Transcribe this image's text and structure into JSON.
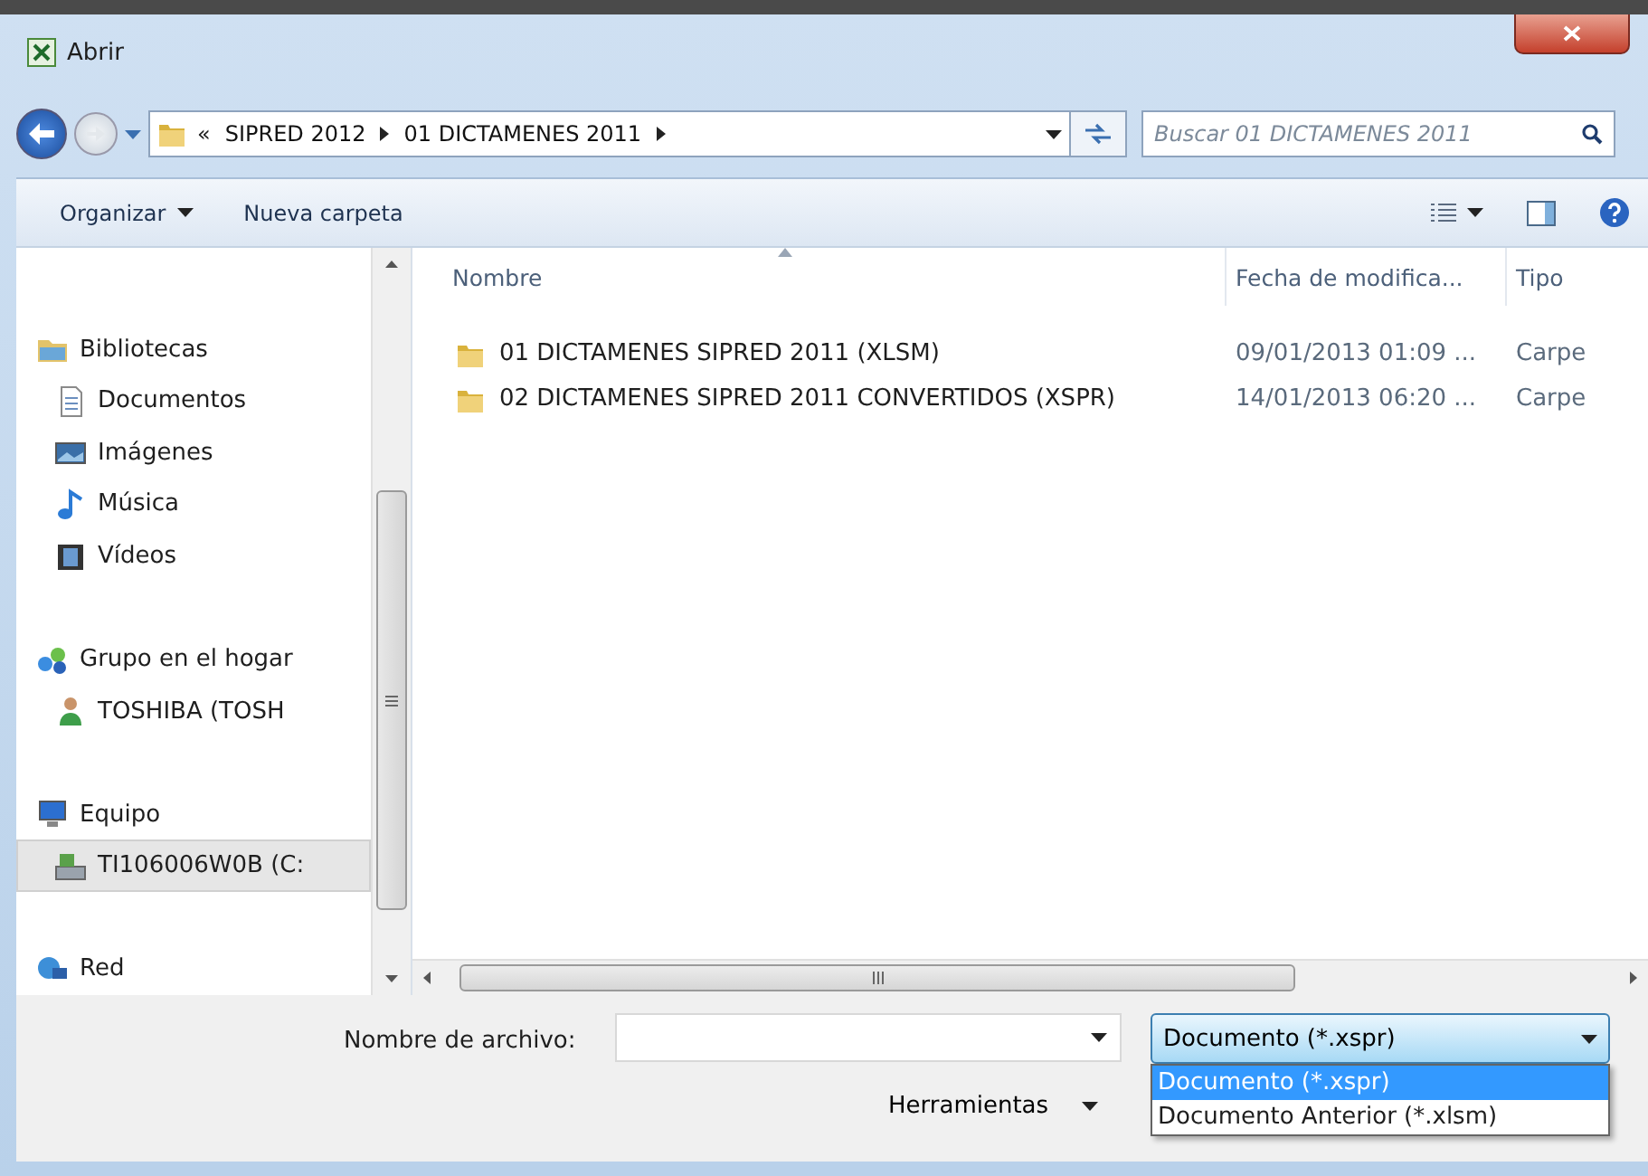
{
  "window": {
    "title": "Abrir"
  },
  "navigation": {
    "overflow": "«",
    "breadcrumb": [
      "SIPRED 2012",
      "01 DICTAMENES 2011"
    ],
    "search": {
      "placeholder": "Buscar 01 DICTAMENES 2011"
    }
  },
  "toolbar": [
    {
      "label": "Organizar",
      "dropdown": true
    },
    {
      "label": "Nueva carpeta",
      "dropdown": false
    }
  ],
  "sidebar": {
    "items": [
      {
        "label": "Bibliotecas",
        "kind": "library",
        "selected": false,
        "children": [
          {
            "label": "Documentos",
            "kind": "documents",
            "selected": false
          },
          {
            "label": "Imágenes",
            "kind": "pictures",
            "selected": false
          },
          {
            "label": "Música",
            "kind": "music",
            "selected": false
          },
          {
            "label": "Vídeos",
            "kind": "videos",
            "selected": false
          }
        ]
      },
      {
        "label": "Grupo en el hogar",
        "kind": "homegroup",
        "selected": false,
        "children": [
          {
            "label": "TOSHIBA (TOSH",
            "kind": "user",
            "selected": false
          }
        ]
      },
      {
        "label": "Equipo",
        "kind": "computer",
        "selected": false,
        "children": [
          {
            "label": "TI106006W0B (C:",
            "kind": "drive",
            "selected": true
          }
        ]
      },
      {
        "label": "Red",
        "kind": "network",
        "selected": false
      }
    ]
  },
  "table": {
    "columns": [
      "Nombre",
      "Fecha de modifica...",
      "Tipo"
    ],
    "rows": [
      {
        "name": "01 DICTAMENES SIPRED 2011 (XLSM)",
        "date": "09/01/2013 01:09 ...",
        "type": "Carpe"
      },
      {
        "name": "02 DICTAMENES SIPRED 2011 CONVERTIDOS (XSPR)",
        "date": "14/01/2013 06:20 ...",
        "type": "Carpe"
      }
    ]
  },
  "file_name": {
    "label": "Nombre de archivo:"
  },
  "file_type": {
    "value": "Documento (*.xspr)",
    "expanded": true,
    "options": [
      {
        "label": "Documento (*.xspr)",
        "selected": true
      },
      {
        "label": "Documento Anterior (*.xlsm)",
        "selected": false
      }
    ]
  },
  "tools": {
    "label": "Herramientas"
  }
}
